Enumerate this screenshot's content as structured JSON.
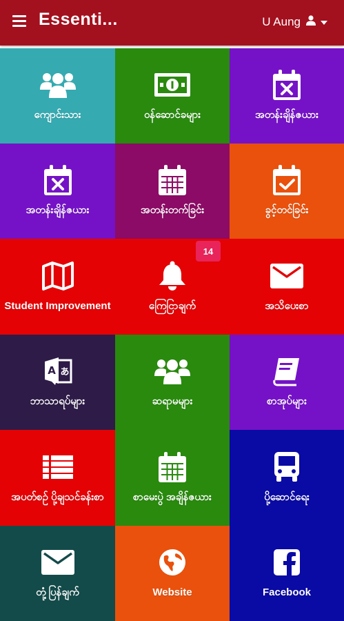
{
  "header": {
    "title": "Essenti...",
    "user_name": "U Aung",
    "menu_icon": "hamburger-icon",
    "user_icon": "user-icon",
    "caret_icon": "caret-down-icon",
    "color": "#a3101e"
  },
  "tiles": [
    {
      "label": "ကျောင်းသား",
      "icon": "users-icon",
      "color": "#35aab1"
    },
    {
      "label": "ဝန်ဆောင်ခများ",
      "icon": "money-icon",
      "color": "#298a0e"
    },
    {
      "label": "အတန်းချိန်ဇယား",
      "icon": "calendar-x-icon",
      "color": "#7512c7"
    },
    {
      "label": "အတန်းချိန်ဇယား",
      "icon": "calendar-x-icon",
      "color": "#7512c7"
    },
    {
      "label": "အတန်းတက်ခြင်း",
      "icon": "calendar-icon",
      "color": "#8c0b66"
    },
    {
      "label": "ခွင့်တင်ခြင်း",
      "icon": "calendar-check-icon",
      "color": "#e9510c"
    },
    {
      "label": "Student Improvement",
      "icon": "map-icon",
      "color": "#e40205"
    },
    {
      "label": "ကြေငြာချက်",
      "icon": "bell-icon",
      "color": "#e40205",
      "badge": "14"
    },
    {
      "label": "အသိပေးစာ",
      "icon": "envelope-icon",
      "color": "#e40205"
    },
    {
      "label": "ဘာသာရပ်များ",
      "icon": "language-icon",
      "color": "#2e1b48"
    },
    {
      "label": "ဆရာမများ",
      "icon": "users-icon",
      "color": "#298a0e"
    },
    {
      "label": "စာအုပ်များ",
      "icon": "book-icon",
      "color": "#7512c7"
    },
    {
      "label": "အပတ်စဉ် ပို့ချသင်ခန်းစာ",
      "icon": "list-icon",
      "color": "#e40205"
    },
    {
      "label": "စာမေးပွဲ အချိန်ဇယား",
      "icon": "calendar-icon",
      "color": "#298a0e"
    },
    {
      "label": "ပို့ဆောင်ရေး",
      "icon": "bus-icon",
      "color": "#0a0aa5"
    },
    {
      "label": "တုံ့ပြန်ချက်",
      "icon": "envelope-icon",
      "color": "#134b4a"
    },
    {
      "label": "Website",
      "icon": "globe-icon",
      "color": "#e9510c"
    },
    {
      "label": "Facebook",
      "icon": "facebook-icon",
      "color": "#0a0aa5"
    }
  ]
}
